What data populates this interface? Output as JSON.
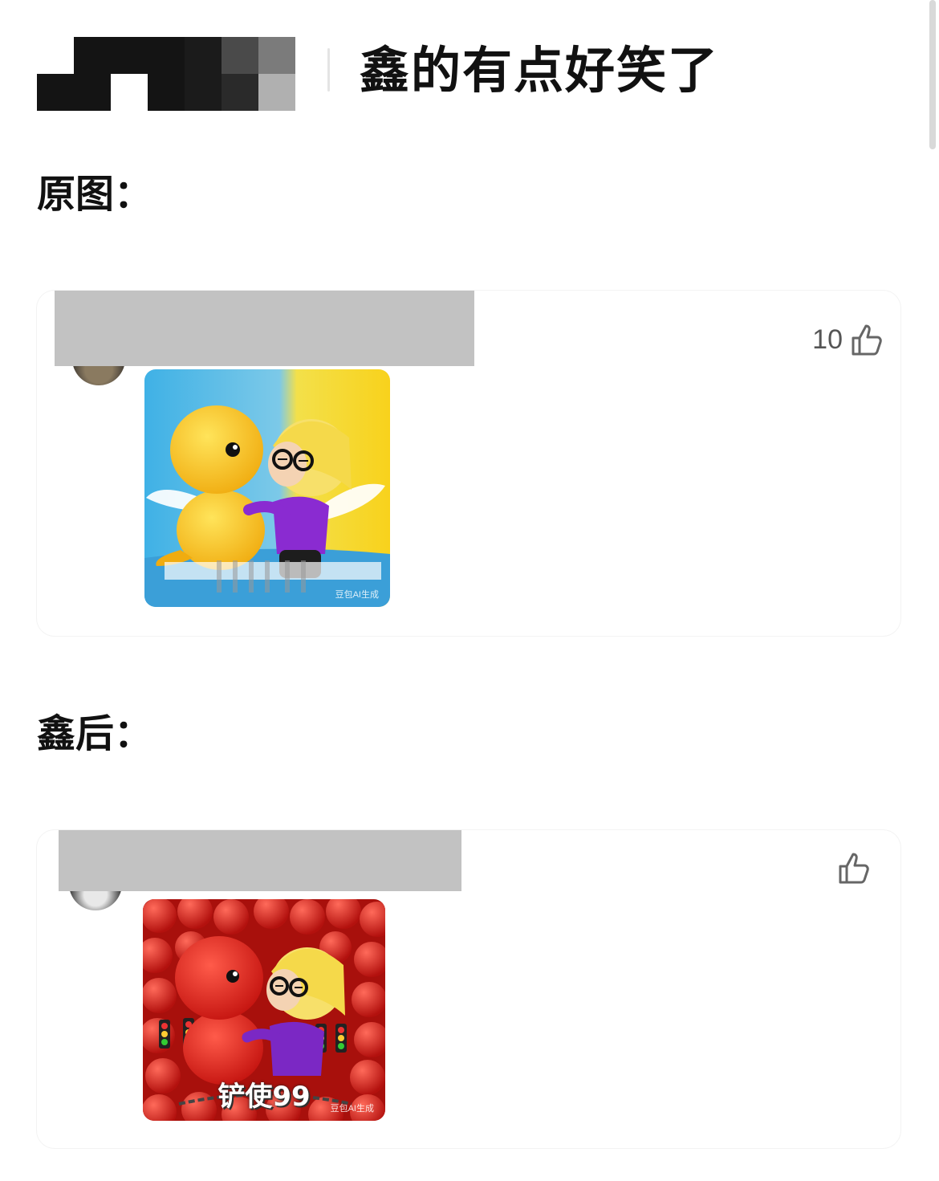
{
  "header": {
    "title": "鑫的有点好笑了"
  },
  "sections": [
    {
      "label": "原图：",
      "comment": {
        "like_count": "10",
        "image": {
          "kind": "meme-yellow-dino-kiss",
          "watermark": "豆包AI生成",
          "accent": "#f5c518"
        }
      }
    },
    {
      "label": "鑫后：",
      "comment": {
        "like_count": "",
        "image": {
          "kind": "meme-red-dino-kiss",
          "caption": "铲使99",
          "watermark": "豆包AI生成",
          "accent": "#d8201c"
        }
      }
    }
  ],
  "colors": {
    "redaction": "#c2c2c2",
    "like_icon": "#666666",
    "text": "#111111"
  }
}
